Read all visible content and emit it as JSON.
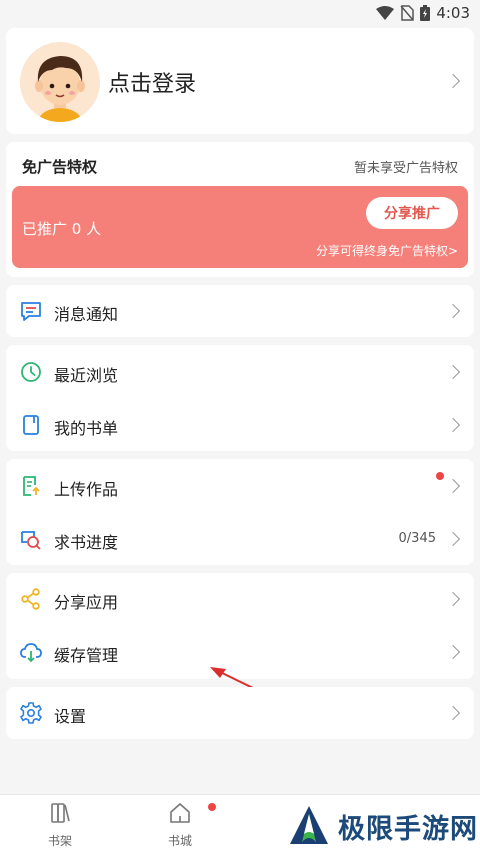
{
  "status_bar": {
    "time": "4:03"
  },
  "profile": {
    "login_label": "点击登录"
  },
  "ad_free": {
    "title": "免广告特权",
    "status": "暂未享受广告特权",
    "promoted_count": "已推广 0 人",
    "share_button": "分享推广",
    "hint": "分享可得终身免广告特权>"
  },
  "menu": {
    "messages": "消息通知",
    "recent": "最近浏览",
    "my_booklist": "我的书单",
    "upload": "上传作品",
    "request_progress": "求书进度",
    "request_progress_value": "0/345",
    "share_app": "分享应用",
    "cache": "缓存管理",
    "settings": "设置"
  },
  "nav": {
    "bookshelf": "书架",
    "bookstore": "书城"
  },
  "watermark": {
    "text": "极限手游网"
  },
  "colors": {
    "accent": "#f5807a",
    "blue_icon": "#2a7fe0",
    "green_icon": "#2bb673",
    "yellow_icon": "#f0b429"
  }
}
